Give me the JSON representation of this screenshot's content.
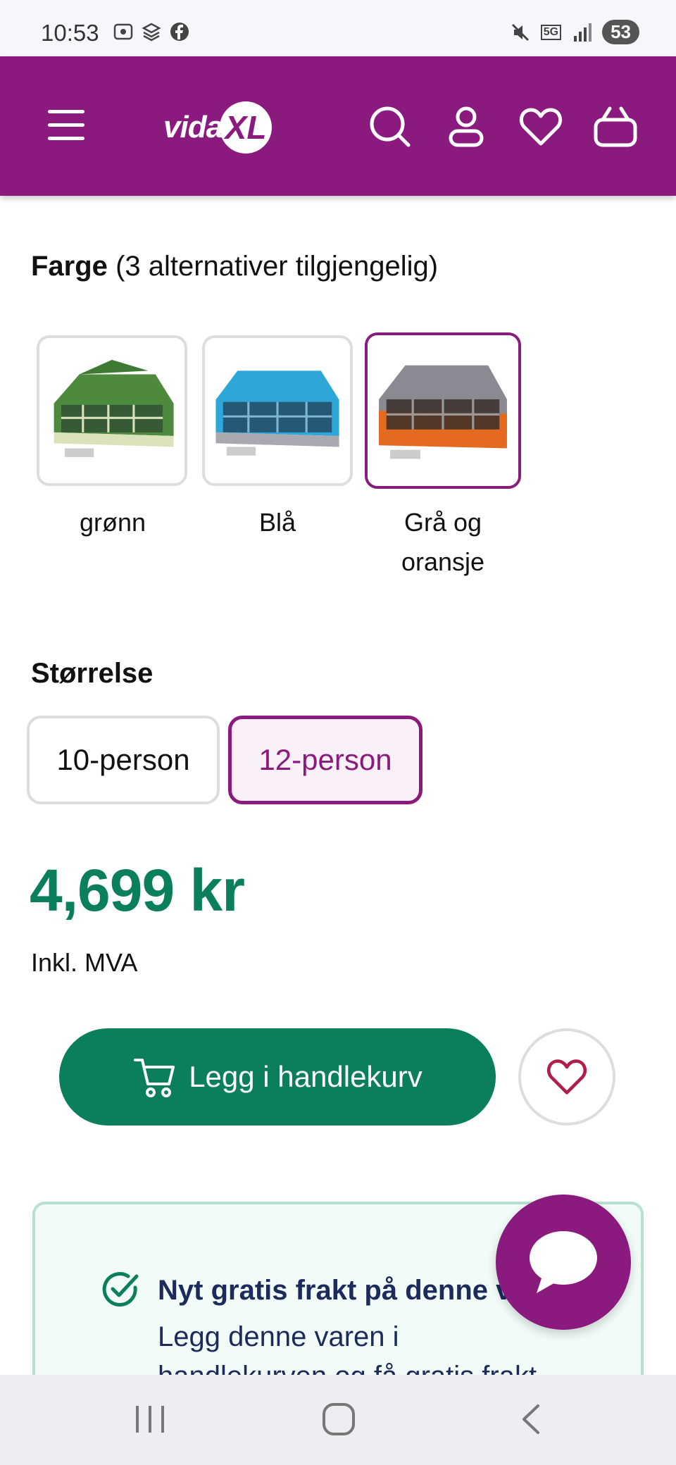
{
  "status_bar": {
    "time": "10:53",
    "network": "5G",
    "battery": "53"
  },
  "header": {
    "logo_text": "vida",
    "logo_mark": "XL",
    "icons": [
      "menu-icon",
      "search-icon",
      "account-icon",
      "heart-icon",
      "basket-icon"
    ]
  },
  "color": {
    "label": "Farge",
    "count_text": "(3 alternativer tilgjengelig)",
    "options": [
      {
        "name": "grønn",
        "selected": false,
        "tent_color": "#4d8a3e"
      },
      {
        "name": "Blå",
        "selected": false,
        "tent_color": "#2fa6d8"
      },
      {
        "name": "Grå og oransje",
        "name_line1": "Grå og",
        "name_line2": "oransje",
        "selected": true,
        "tent_color": "#e36a1f"
      }
    ]
  },
  "size": {
    "label": "Størrelse",
    "options": [
      {
        "label": "10-person",
        "selected": false
      },
      {
        "label": "12-person",
        "selected": true
      }
    ]
  },
  "price": {
    "value": "4,699 kr",
    "vat": "Inkl. MVA"
  },
  "actions": {
    "add_to_cart": "Legg i handlekurv"
  },
  "shipping": {
    "title": "Nyt gratis frakt på denne v",
    "line1": "Legg denne varen i",
    "line2": "handlekurven og få gratis frakt"
  },
  "colors": {
    "brand": "#8b1a7e",
    "accent_green": "#0b7f5b"
  }
}
